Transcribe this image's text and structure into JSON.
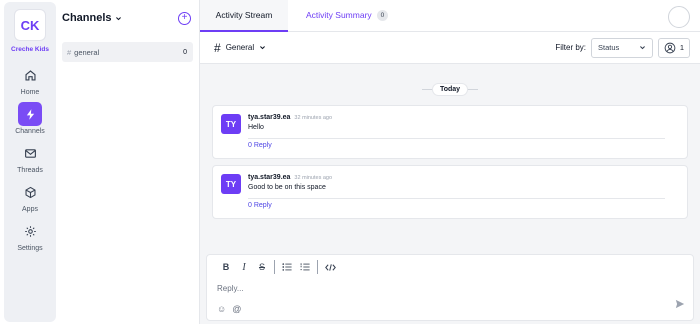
{
  "workspace": {
    "initials": "CK",
    "name": "Creche Kids"
  },
  "nav": [
    {
      "label": "Home",
      "icon": "home-icon"
    },
    {
      "label": "Channels",
      "icon": "lightning-icon",
      "active": true
    },
    {
      "label": "Threads",
      "icon": "mail-icon"
    },
    {
      "label": "Apps",
      "icon": "cube-icon"
    },
    {
      "label": "Settings",
      "icon": "gear-icon"
    }
  ],
  "channels": {
    "title": "Channels",
    "items": [
      {
        "name": "general",
        "count": "0"
      }
    ]
  },
  "tabs": {
    "stream": "Activity Stream",
    "summary": "Activity Summary",
    "summary_badge": "0"
  },
  "filter": {
    "channel": "General",
    "label": "Filter by:",
    "status": "Status",
    "members": "1"
  },
  "stream": {
    "day": "Today",
    "messages": [
      {
        "initials": "TY",
        "user": "tya.star39.ea",
        "time": "32 minutes ago",
        "text": "Hello",
        "reply": "0 Reply"
      },
      {
        "initials": "TY",
        "user": "tya.star39.ea",
        "time": "32 minutes ago",
        "text": "Good to be on this space",
        "reply": "0 Reply"
      }
    ]
  },
  "composer": {
    "placeholder": "Reply..."
  },
  "colors": {
    "accent": "#6d3df5",
    "rail_bg": "#eef0f4",
    "link": "#4f46e5"
  }
}
